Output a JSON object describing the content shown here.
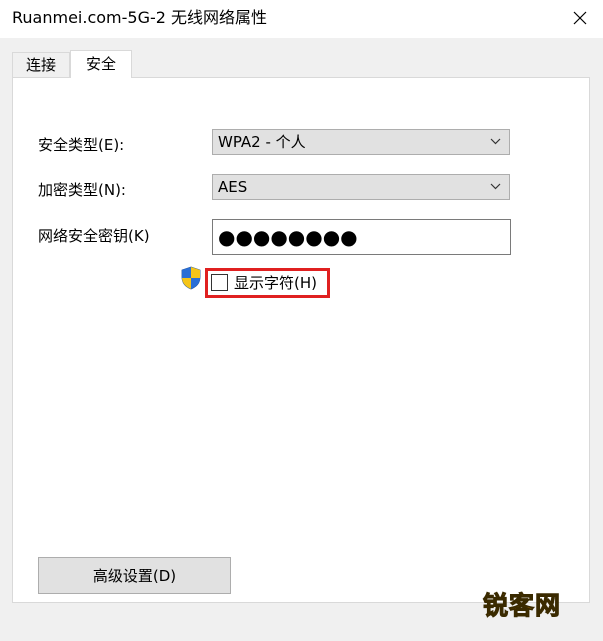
{
  "window": {
    "title": "Ruanmei.com-5G-2 无线网络属性"
  },
  "tabs": [
    {
      "label": "连接",
      "active": false
    },
    {
      "label": "安全",
      "active": true
    }
  ],
  "security": {
    "security_type_label": "安全类型(E):",
    "security_type_value": "WPA2 - 个人",
    "encryption_type_label": "加密类型(N):",
    "encryption_type_value": "AES",
    "network_key_label": "网络安全密钥(K)",
    "network_key_value": "●●●●●●●●",
    "show_characters_label": "显示字符(H)",
    "show_characters_checked": false
  },
  "advanced_button_label": "高级设置(D)",
  "watermark": "锐客网",
  "colors": {
    "highlight_border": "#e02020",
    "watermark": "#ff9a00",
    "panel_bg": "#ffffff",
    "window_bg": "#f0f0f0"
  },
  "icons": {
    "close": "close-icon",
    "dropdown": "chevron-down-icon",
    "uac_shield": "shield-icon"
  }
}
